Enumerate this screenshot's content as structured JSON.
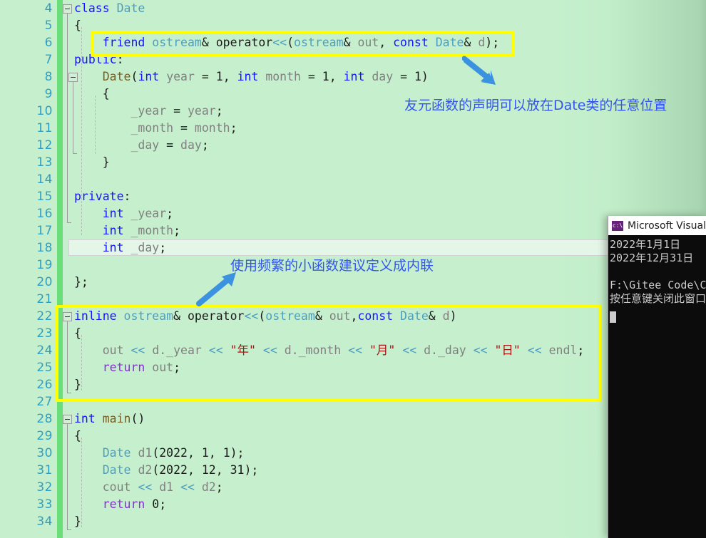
{
  "editor": {
    "background_color": "#c6f0cd",
    "line_numbers": [
      4,
      5,
      6,
      7,
      8,
      9,
      10,
      11,
      12,
      13,
      14,
      15,
      16,
      17,
      18,
      19,
      20,
      21,
      22,
      23,
      24,
      25,
      26,
      27,
      28,
      29,
      30,
      31,
      32,
      33,
      34
    ],
    "current_line": 18,
    "code_lines": [
      {
        "n": 4,
        "text": "class Date"
      },
      {
        "n": 5,
        "text": "{"
      },
      {
        "n": 6,
        "text": "    friend ostream& operator<<(ostream& out, const Date& d);"
      },
      {
        "n": 7,
        "text": "public:"
      },
      {
        "n": 8,
        "text": "    Date(int year = 1, int month = 1, int day = 1)"
      },
      {
        "n": 9,
        "text": "    {"
      },
      {
        "n": 10,
        "text": "        _year = year;"
      },
      {
        "n": 11,
        "text": "        _month = month;"
      },
      {
        "n": 12,
        "text": "        _day = day;"
      },
      {
        "n": 13,
        "text": "    }"
      },
      {
        "n": 14,
        "text": ""
      },
      {
        "n": 15,
        "text": "private:"
      },
      {
        "n": 16,
        "text": "    int _year;"
      },
      {
        "n": 17,
        "text": "    int _month;"
      },
      {
        "n": 18,
        "text": "    int _day;"
      },
      {
        "n": 19,
        "text": ""
      },
      {
        "n": 20,
        "text": "};"
      },
      {
        "n": 21,
        "text": ""
      },
      {
        "n": 22,
        "text": "inline ostream& operator<<(ostream& out,const Date& d)"
      },
      {
        "n": 23,
        "text": "{"
      },
      {
        "n": 24,
        "text": "    out << d._year << \"年\" << d._month << \"月\" << d._day << \"日\" << endl;"
      },
      {
        "n": 25,
        "text": "    return out;"
      },
      {
        "n": 26,
        "text": "}"
      },
      {
        "n": 27,
        "text": ""
      },
      {
        "n": 28,
        "text": "int main()"
      },
      {
        "n": 29,
        "text": "{"
      },
      {
        "n": 30,
        "text": "    Date d1(2022, 1, 1);"
      },
      {
        "n": 31,
        "text": "    Date d2(2022, 12, 31);"
      },
      {
        "n": 32,
        "text": "    cout << d1 << d2;"
      },
      {
        "n": 33,
        "text": "    return 0;"
      },
      {
        "n": 34,
        "text": "}"
      }
    ]
  },
  "annotations": [
    {
      "id": "friend-note",
      "text": "友元函数的声明可以放在Date类的任意位置",
      "color": "#3355ee"
    },
    {
      "id": "inline-note",
      "text": "使用频繁的小函数建议定义成内联",
      "color": "#3355ee"
    }
  ],
  "highlight_boxes": [
    {
      "id": "friend-decl-box",
      "color": "#ffff00"
    },
    {
      "id": "inline-operator-box",
      "color": "#ffff00"
    }
  ],
  "console": {
    "title": "Microsoft Visual St",
    "icon_label": "c:\\",
    "output_lines": [
      "2022年1月1日",
      "2022年12月31日",
      "",
      "F:\\Gitee Code\\C++",
      "按任意键关闭此窗口"
    ]
  }
}
